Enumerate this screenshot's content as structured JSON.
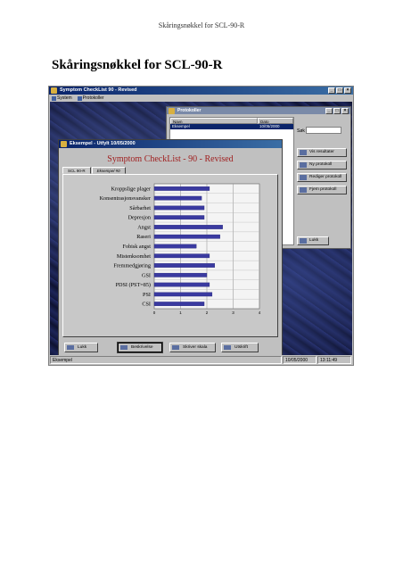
{
  "page_header": "Skåringsnøkkel for SCL-90-R",
  "page_title": "Skåringsnøkkel for SCL-90-R",
  "app": {
    "title": "Symptom CheckList 90 - Revised",
    "menu": [
      "System",
      "Protokoller"
    ],
    "status": {
      "left": "Eksempel",
      "date": "10/05/2000",
      "time": "13:11:49"
    }
  },
  "protocol_window": {
    "title": "Protokoller",
    "columns": [
      "Navn",
      "Dato"
    ],
    "rows": [
      {
        "name": "Eksempel",
        "date": "10/05/2000"
      }
    ],
    "search_label": "Søk",
    "search_value": "",
    "buttons": [
      "Vis resultater",
      "Ny protokoll",
      "Rediger protokoll",
      "Fjern protokoll"
    ],
    "close_label": "Lukk"
  },
  "result_window": {
    "title": "Eksempel - Utfylt 10/05/2000",
    "heading": "Symptom CheckList - 90 - Revised",
    "tabs": [
      "SCL 90-R",
      "Eksempel #0"
    ],
    "buttons": [
      "Lukk",
      "Beskrivelse",
      "Skriver skala",
      "Utskrift"
    ]
  },
  "chart_data": {
    "type": "bar",
    "orientation": "horizontal",
    "categories": [
      "Kroppslige plager",
      "Konsentrasjonsvansker",
      "Sårbarhet",
      "Depresjon",
      "Angst",
      "Raseri",
      "Fobisk angst",
      "Mistenksomhet",
      "Fremmedgjøring",
      "GSI",
      "PDSI (PST=85)",
      "PSI",
      "CSI"
    ],
    "series": [
      {
        "values": [
          2.1,
          1.8,
          1.9,
          1.9,
          2.6,
          2.5,
          1.6,
          2.1,
          2.3,
          2.0,
          2.1,
          2.2,
          1.9
        ]
      }
    ],
    "xlim": [
      0,
      4
    ],
    "ticks": [
      "0",
      "1",
      "2",
      "3",
      "4"
    ],
    "grid": true,
    "bar_color": "#3a3aa0"
  }
}
